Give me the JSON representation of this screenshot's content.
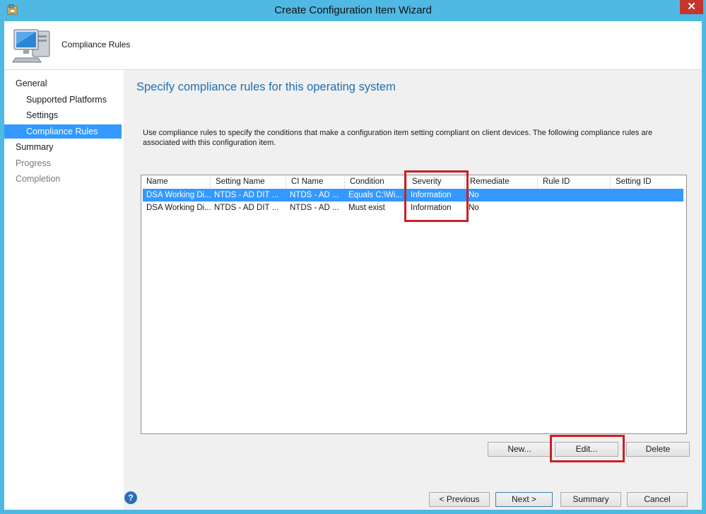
{
  "window": {
    "title": "Create Configuration Item Wizard",
    "close_glyph": "✕"
  },
  "header": {
    "title": "Compliance Rules"
  },
  "nav": {
    "items": [
      {
        "label": "General"
      },
      {
        "label": "Supported Platforms"
      },
      {
        "label": "Settings"
      },
      {
        "label": "Compliance Rules"
      },
      {
        "label": "Summary"
      },
      {
        "label": "Progress"
      },
      {
        "label": "Completion"
      }
    ]
  },
  "main": {
    "title": "Specify compliance rules for this operating system",
    "description": "Use compliance rules to specify the conditions that make a configuration item setting compliant on client devices. The following compliance rules are associated with this configuration item."
  },
  "table": {
    "columns": [
      "Name",
      "Setting Name",
      "CI Name",
      "Condition",
      "Severity",
      "Remediate",
      "Rule ID",
      "Setting ID"
    ],
    "rows": [
      [
        "DSA Working Di...",
        "NTDS - AD DIT ...",
        "NTDS - AD ...",
        "Equals C:\\Wi...",
        "Information",
        "No",
        "",
        ""
      ],
      [
        "DSA Working Di...",
        "NTDS - AD DIT ...",
        "NTDS - AD ...",
        "Must exist",
        "Information",
        "No",
        "",
        ""
      ]
    ]
  },
  "list_buttons": {
    "new": "New...",
    "edit": "Edit...",
    "delete": "Delete"
  },
  "footer": {
    "help": "?",
    "previous": "< Previous",
    "next": "Next >",
    "summary": "Summary",
    "cancel": "Cancel"
  },
  "colors": {
    "accent": "#3399ff",
    "title_blue": "#1f6fb5",
    "highlight_red": "#cc1f26",
    "frame": "#4fb8e3"
  }
}
